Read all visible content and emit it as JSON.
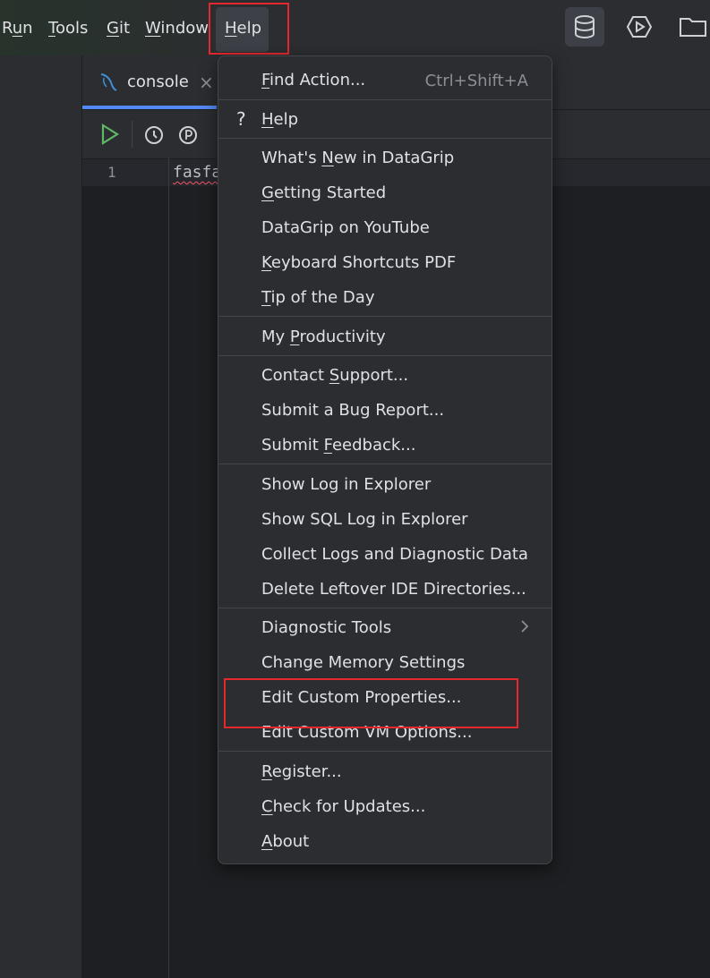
{
  "menubar": {
    "items": [
      {
        "label": "Run"
      },
      {
        "label": "Tools"
      },
      {
        "label": "Git"
      },
      {
        "label": "Window"
      },
      {
        "label": "Help"
      }
    ],
    "icons": [
      "database-icon",
      "run-configuration-icon",
      "folder-icon"
    ]
  },
  "tabs": [
    {
      "label": "console",
      "close": "×"
    }
  ],
  "editor": {
    "line_number": "1",
    "code": "fasfa"
  },
  "help_menu": {
    "find_action": {
      "label": "Find Action...",
      "shortcut": "Ctrl+Shift+A"
    },
    "help_qmark": "?",
    "help": "Help",
    "whats_new": "What's New in DataGrip",
    "getting_started": "Getting Started",
    "youtube": "DataGrip on YouTube",
    "keyboard_pdf": "Keyboard Shortcuts PDF",
    "tip": "Tip of the Day",
    "productivity": "My Productivity",
    "contact_support": "Contact Support...",
    "submit_bug": "Submit a Bug Report...",
    "submit_feedback": "Submit Feedback...",
    "show_log": "Show Log in Explorer",
    "show_sql_log": "Show SQL Log in Explorer",
    "collect_logs": "Collect Logs and Diagnostic Data",
    "delete_leftover": "Delete Leftover IDE Directories...",
    "diagnostic_tools": "Diagnostic Tools",
    "change_memory": "Change Memory Settings",
    "edit_properties": "Edit Custom Properties...",
    "edit_vm": "Edit Custom VM Options...",
    "register": "Register...",
    "check_updates": "Check for Updates...",
    "about": "About"
  },
  "colors": {
    "highlight_box": "#e5272e",
    "accent": "#548af7",
    "run_green": "#5fb865"
  }
}
